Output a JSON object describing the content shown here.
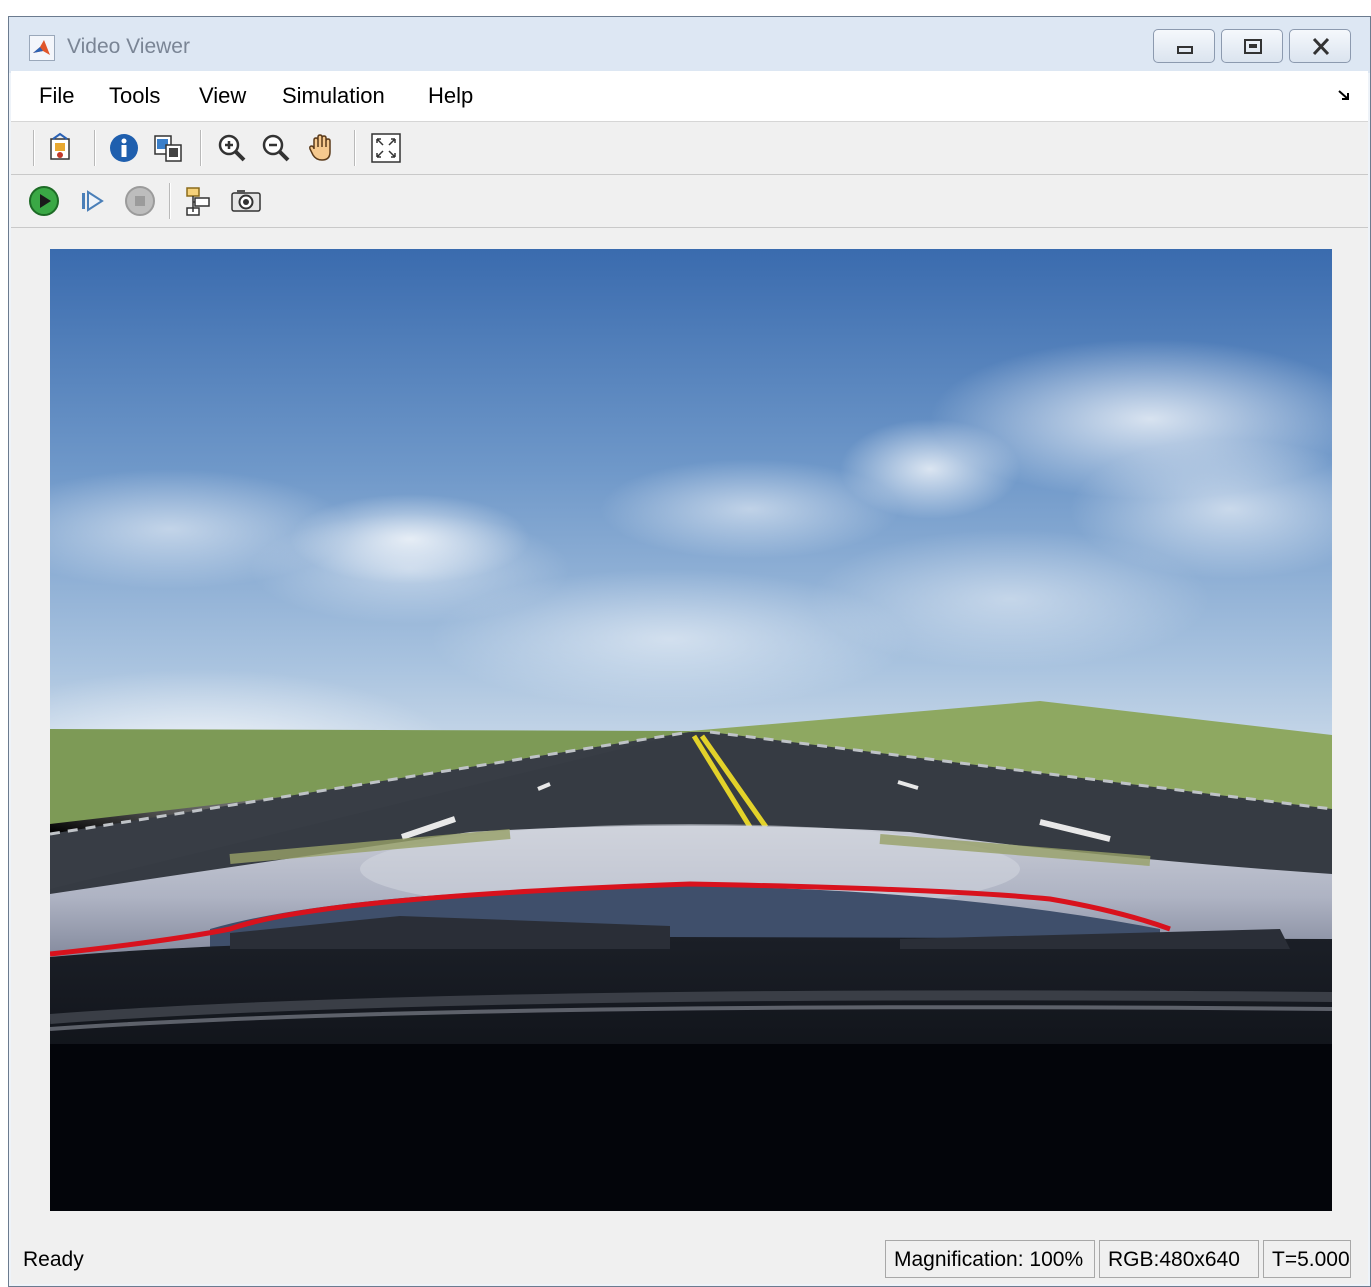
{
  "window": {
    "title": "Video Viewer",
    "accent": "#dde7f3",
    "controls": [
      "minimize-icon",
      "maximize-icon",
      "close-icon"
    ]
  },
  "menubar": {
    "items": [
      "File",
      "Tools",
      "View",
      "Simulation",
      "Help"
    ],
    "overflow_icon": "dock-arrow-icon"
  },
  "toolbar1": {
    "buttons": [
      "open-model-icon",
      "info-icon",
      "copy-image-icon",
      "zoom-in-icon",
      "zoom-out-icon",
      "pan-hand-icon",
      "fit-to-view-icon"
    ]
  },
  "toolbar2": {
    "buttons": [
      "run-icon",
      "step-forward-icon",
      "stop-icon",
      "highlight-block-icon",
      "snapshot-camera-icon"
    ]
  },
  "status": {
    "state": "Ready",
    "magnification": "Magnification: 100%",
    "format": "RGB:480x640",
    "time": "T=5.000"
  }
}
